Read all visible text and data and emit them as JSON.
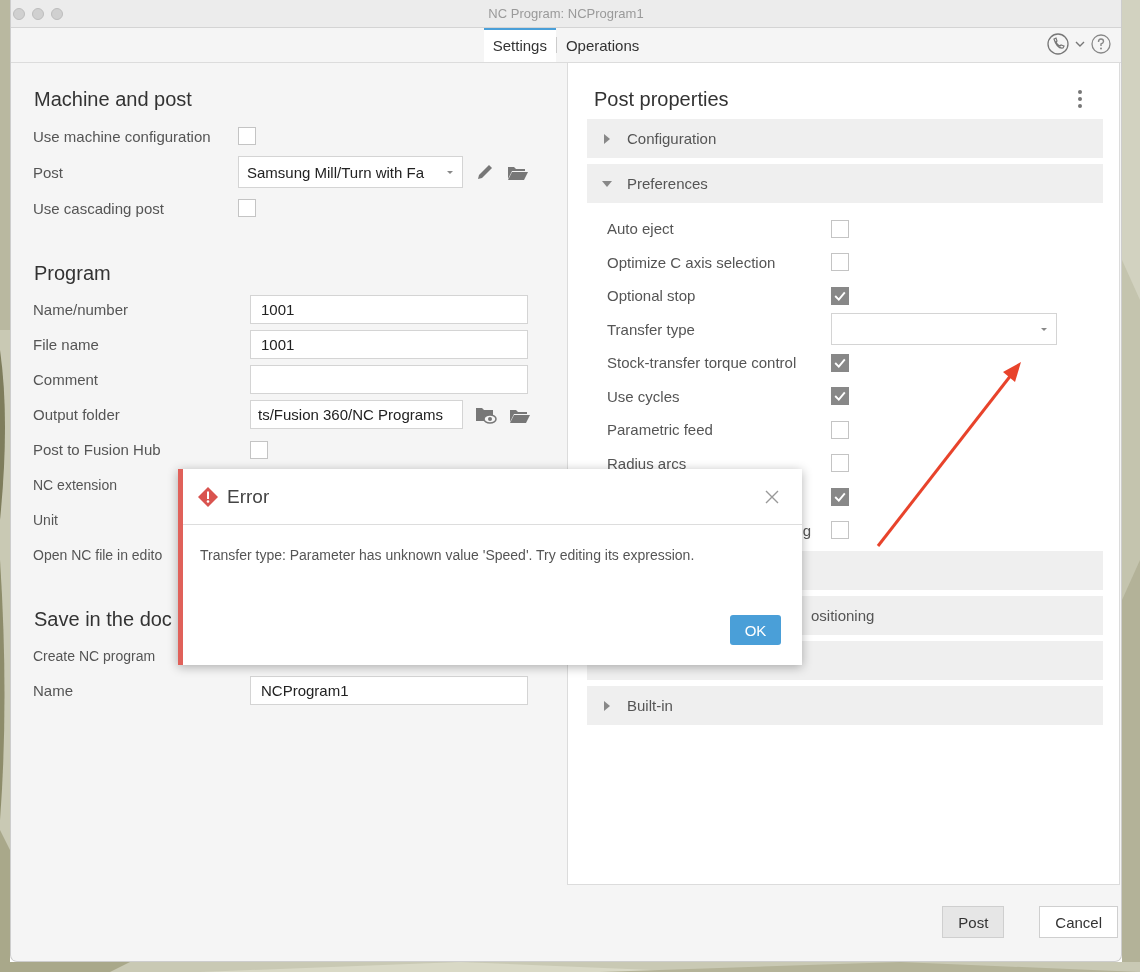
{
  "window": {
    "title": "NC Program: NCProgram1"
  },
  "tabs": [
    {
      "label": "Settings",
      "selected": true
    },
    {
      "label": "Operations",
      "selected": false
    }
  ],
  "left_panel": {
    "sections": [
      {
        "heading": "Machine and post",
        "rows": [
          {
            "kind": "checkbox",
            "label": "Use machine configuration",
            "checked": false
          },
          {
            "kind": "dropdown",
            "label": "Post",
            "value": "Samsung Mill/Turn with Fa"
          },
          {
            "kind": "checkbox",
            "label": "Use cascading post",
            "checked": false
          }
        ]
      },
      {
        "heading": "Program",
        "rows": [
          {
            "kind": "text",
            "label": "Name/number",
            "value": "1001"
          },
          {
            "kind": "text",
            "label": "File name",
            "value": "1001"
          },
          {
            "kind": "text",
            "label": "Comment"
          },
          {
            "kind": "folder",
            "label": "Output folder",
            "value": "ts/Fusion 360/NC Programs"
          },
          {
            "kind": "checkbox",
            "label": "Post to Fusion Hub",
            "checked": false
          },
          {
            "kind": "covered",
            "label": "NC extension"
          },
          {
            "kind": "covered",
            "label": "Unit"
          },
          {
            "kind": "covered",
            "label": "Open NC file in edito"
          }
        ]
      },
      {
        "heading": "Save in the doc",
        "rows": [
          {
            "kind": "covered",
            "label": "Create NC program"
          },
          {
            "kind": "text",
            "label": "Name",
            "value": "NCProgram1"
          }
        ]
      }
    ]
  },
  "post_properties": {
    "title": "Post properties",
    "groups": [
      {
        "kind": "full",
        "label": "Configuration",
        "expanded": false
      },
      {
        "kind": "full",
        "label": "Preferences",
        "expanded": true,
        "rows": [
          {
            "kind": "checkbox",
            "label": "Auto eject",
            "checked": false
          },
          {
            "kind": "checkbox",
            "label": "Optimize C axis selection",
            "checked": false
          },
          {
            "kind": "checkbox",
            "label": "Optional stop",
            "checked": true
          },
          {
            "kind": "dropdown",
            "label": "Transfer type"
          },
          {
            "kind": "checkbox",
            "label": "Stock-transfer torque control",
            "checked": true
          },
          {
            "kind": "checkbox",
            "label": "Use cycles",
            "checked": true
          },
          {
            "kind": "checkbox",
            "label": "Parametric feed",
            "checked": false
          },
          {
            "kind": "checkbox",
            "label": "Radius arcs",
            "checked": false
          },
          {
            "kind": "covered-checkbox",
            "checked": true
          },
          {
            "kind": "covered-checkbox",
            "label": "g",
            "checked": false
          }
        ]
      },
      {
        "kind": "covered"
      },
      {
        "kind": "covered",
        "label": "ositioning"
      },
      {
        "kind": "covered"
      },
      {
        "kind": "full",
        "label": "Built-in",
        "expanded": false
      }
    ]
  },
  "dialog": {
    "title": "Error",
    "message": "Transfer type: Parameter has unknown value 'Speed'. Try editing its expression.",
    "button": "OK"
  },
  "buttons": [
    {
      "label": "Post",
      "primary": true
    },
    {
      "label": "Cancel",
      "primary": false
    }
  ]
}
